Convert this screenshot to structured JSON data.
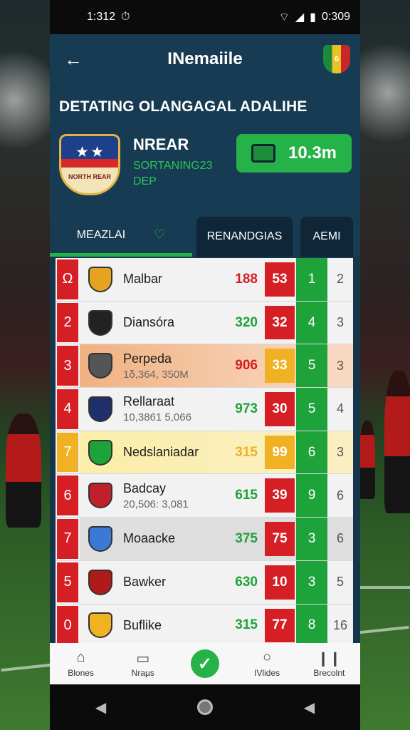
{
  "status_bar": {
    "time": "1:312",
    "right_time": "0:309"
  },
  "header": {
    "back_icon": "arrow-left-icon",
    "title": "INemaiile",
    "crest_label": "6"
  },
  "team": {
    "heading": "DETATING OLANGAGAL ADALIHE",
    "name": "NREAR",
    "subtitle": "SORTANING23",
    "subtitle2": "DEP",
    "value": "10.3m",
    "crest_text": "NORTH REAR"
  },
  "tabs": [
    {
      "label": "MEAZLAI",
      "active": true
    },
    {
      "label": "RENANDGIAS",
      "active": false
    },
    {
      "label": "AEMI",
      "active": false
    }
  ],
  "table": {
    "rows": [
      {
        "pos": "Ω",
        "name": "Malbar",
        "sub": "",
        "pts": "188",
        "pts_color": "#d51f24",
        "mid": "53",
        "g": "1",
        "last": "2",
        "style": "normal",
        "logo_color": "#e4a320"
      },
      {
        "pos": "2",
        "name": "Diansóra",
        "sub": "",
        "pts": "320",
        "pts_color": "#1ea33b",
        "mid": "32",
        "g": "4",
        "last": "3",
        "style": "normal",
        "logo_color": "#222222"
      },
      {
        "pos": "3",
        "name": "Perpeda",
        "sub": "1δ,364, 350M",
        "pts": "906",
        "pts_color": "#d51f24",
        "mid": "33",
        "g": "5",
        "last": "3",
        "style": "orange",
        "logo_color": "#555555"
      },
      {
        "pos": "4",
        "name": "Rellaraat",
        "sub": "10,3861 5,066",
        "pts": "973",
        "pts_color": "#1ea33b",
        "mid": "30",
        "g": "5",
        "last": "4",
        "style": "normal",
        "logo_color": "#1e2f6a"
      },
      {
        "pos": "7",
        "name": "Nedslaniadar",
        "sub": "",
        "pts": "315",
        "pts_color": "#f0b123",
        "mid": "99",
        "g": "6",
        "last": "3",
        "style": "yellow",
        "logo_color": "#1ea33b"
      },
      {
        "pos": "6",
        "name": "Badcay",
        "sub": "20,506: 3,081",
        "pts": "615",
        "pts_color": "#1ea33b",
        "mid": "39",
        "g": "9",
        "last": "6",
        "style": "normal",
        "logo_color": "#c0202a"
      },
      {
        "pos": "7",
        "name": "Moaacke",
        "sub": "",
        "pts": "375",
        "pts_color": "#1ea33b",
        "mid": "75",
        "g": "3",
        "last": "6",
        "style": "gray",
        "logo_color": "#3a7ad6"
      },
      {
        "pos": "5",
        "name": "Bawker",
        "sub": "",
        "pts": "630",
        "pts_color": "#1ea33b",
        "mid": "10",
        "g": "3",
        "last": "5",
        "style": "normal",
        "logo_color": "#b01a1a"
      },
      {
        "pos": "0",
        "name": "Buflike",
        "sub": "",
        "pts": "315",
        "pts_color": "#1ea33b",
        "mid": "77",
        "g": "8",
        "last": "16",
        "style": "normal",
        "logo_color": "#f0b123"
      }
    ]
  },
  "bottom_nav": [
    {
      "label": "Blones",
      "icon": "home-icon"
    },
    {
      "label": "Nraµs",
      "icon": "news-icon"
    },
    {
      "label": "",
      "icon": "check-icon"
    },
    {
      "label": "IVlides",
      "icon": "chat-icon"
    },
    {
      "label": "Brecolnt",
      "icon": "stats-icon"
    }
  ],
  "colors": {
    "accent": "#25b248",
    "red": "#d51f24",
    "header_bg": "#173b52"
  }
}
